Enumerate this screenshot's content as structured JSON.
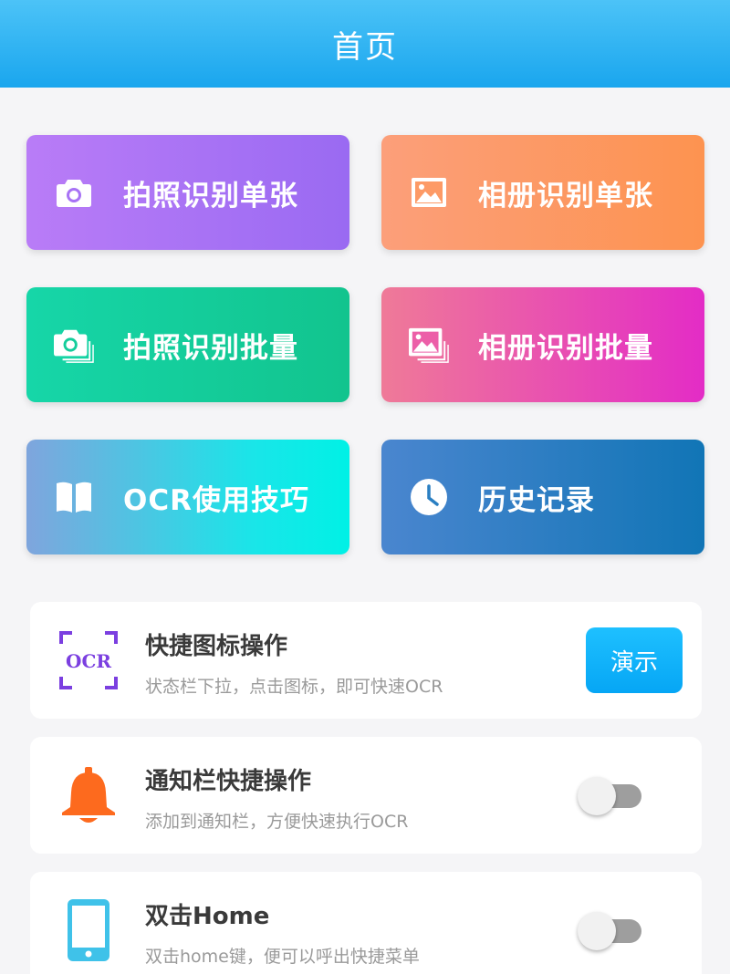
{
  "header": {
    "title": "首页"
  },
  "tiles": [
    {
      "label": "拍照识别单张",
      "icon": "camera-icon"
    },
    {
      "label": "相册识别单张",
      "icon": "image-icon"
    },
    {
      "label": "拍照识别批量",
      "icon": "camera-batch-icon"
    },
    {
      "label": "相册识别批量",
      "icon": "image-batch-icon"
    },
    {
      "label": "OCR使用技巧",
      "icon": "book-icon"
    },
    {
      "label": "历史记录",
      "icon": "clock-icon"
    }
  ],
  "settings": [
    {
      "title": "快捷图标操作",
      "subtitle": "状态栏下拉，点击图标，即可快速OCR",
      "icon": "ocr-scan-icon",
      "icon_text": "OCR",
      "action": "button",
      "button_label": "演示"
    },
    {
      "title": "通知栏快捷操作",
      "subtitle": "添加到通知栏，方便快速执行OCR",
      "icon": "bell-icon",
      "action": "toggle",
      "enabled": false
    },
    {
      "title": "双击Home",
      "subtitle": "双击home键，便可以呼出快捷菜单",
      "icon": "phone-icon",
      "action": "toggle",
      "enabled": false
    }
  ],
  "colors": {
    "header": "#1aa6ee",
    "accent_button": "#06a6f5",
    "bell": "#fd6a1e",
    "phone": "#3fc2e9",
    "ocr_icon": "#7b3fe0"
  }
}
